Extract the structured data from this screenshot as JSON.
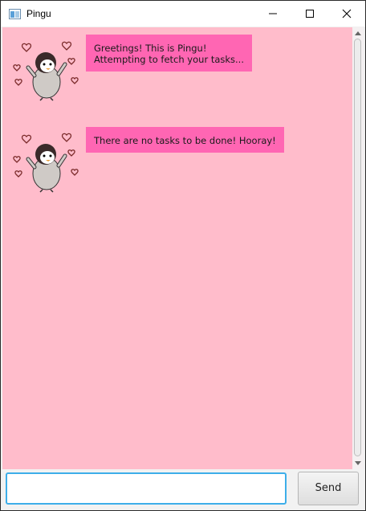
{
  "window": {
    "title": "Pingu",
    "icon": "java-app-icon"
  },
  "dialog": [
    {
      "speaker": "Pingu",
      "avatar": "penguin-hearts-avatar",
      "text": "Greetings! This is Pingu!\nAttempting to fetch your tasks..."
    },
    {
      "speaker": "Pingu",
      "avatar": "penguin-hearts-avatar",
      "text": "There are no tasks to be done! Hooray!"
    }
  ],
  "input": {
    "value": "",
    "placeholder": ""
  },
  "send_button": {
    "label": "Send"
  },
  "colors": {
    "background": "#ffbccb",
    "bubble": "#ff66b3",
    "input_focus": "#3daee9"
  }
}
